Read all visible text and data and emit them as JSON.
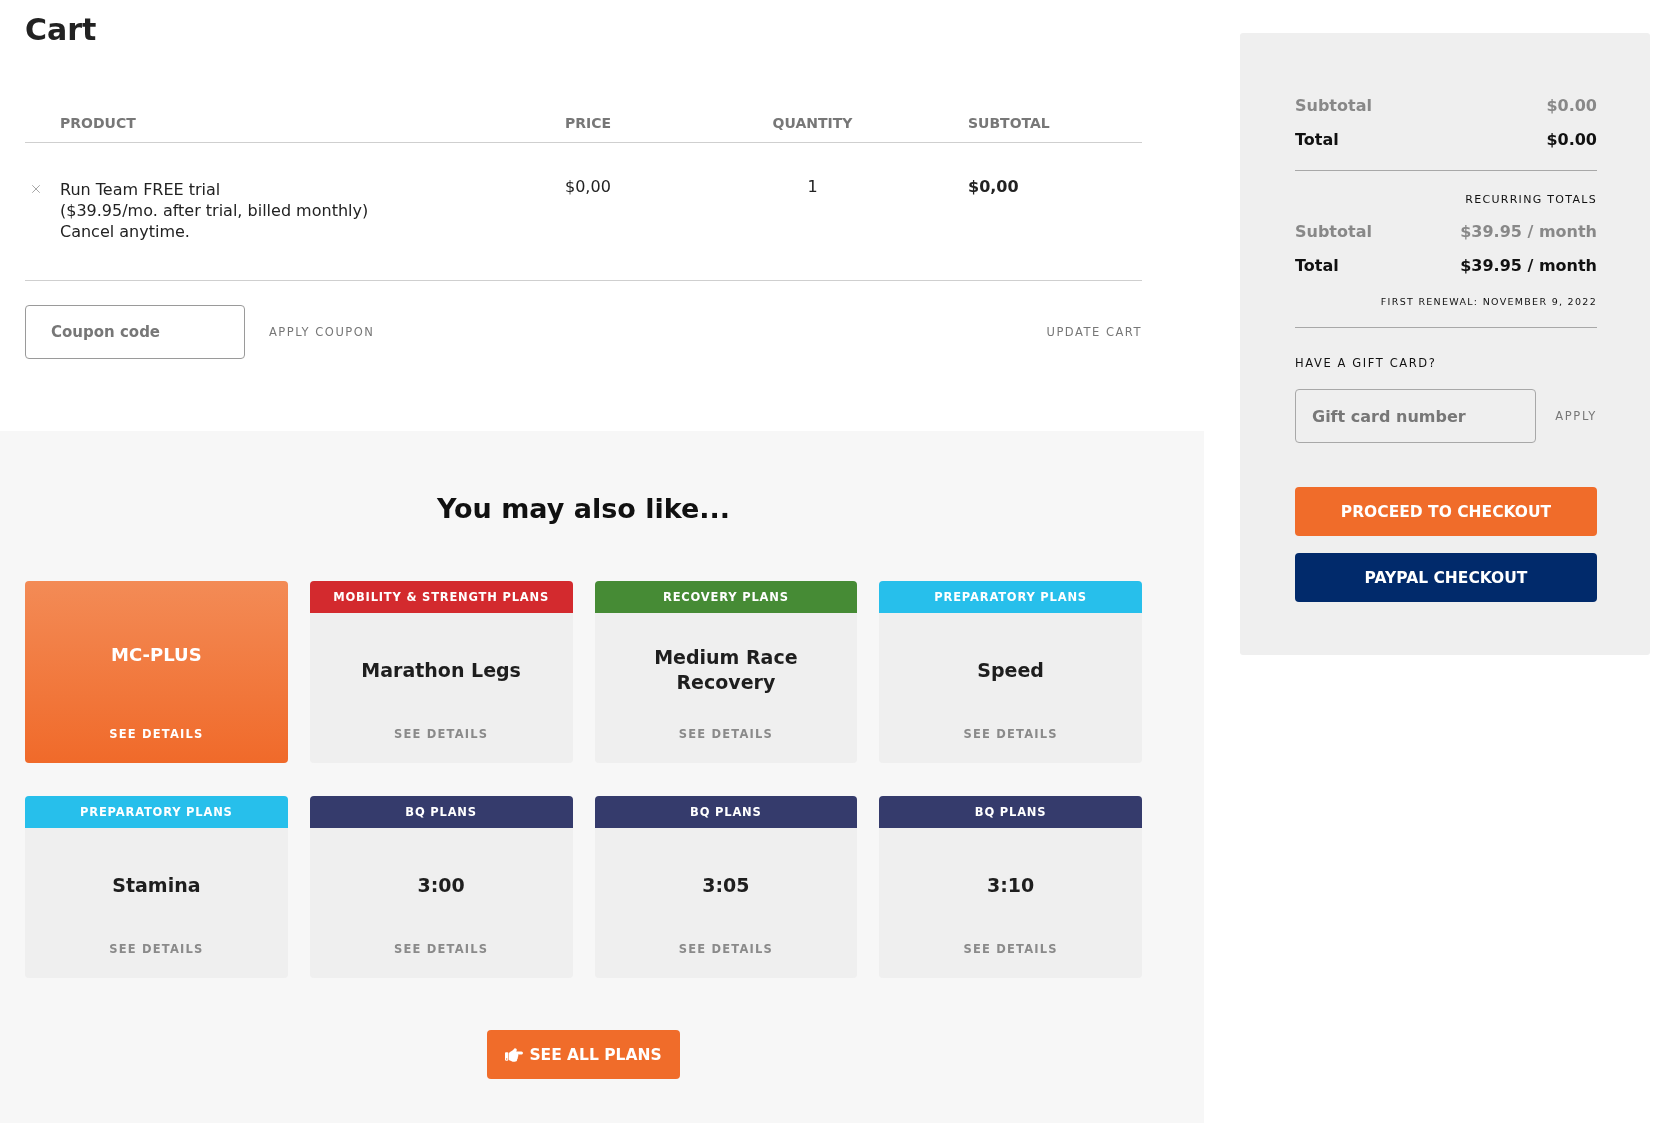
{
  "page": {
    "title": "Cart"
  },
  "cart_table": {
    "columns": [
      "PRODUCT",
      "PRICE",
      "QUANTITY",
      "SUBTOTAL"
    ],
    "rows": [
      {
        "product": "Run Team FREE trial\n($39.95/mo. after trial, billed monthly)\nCancel anytime.",
        "price": "$0,00",
        "quantity": "1",
        "subtotal": "$0,00"
      }
    ]
  },
  "coupon": {
    "placeholder": "Coupon code",
    "apply_button": "APPLY COUPON",
    "update_button": "UPDATE CART"
  },
  "recommendations": {
    "title": "You may also like...",
    "cards": [
      {
        "kind": "featured",
        "name": "MC-PLUS",
        "link": "SEE DETAILS"
      },
      {
        "kind": "category",
        "category": "MOBILITY & STRENGTH PLANS",
        "color": "#d32a2e",
        "name": "Marathon Legs",
        "link": "SEE DETAILS"
      },
      {
        "kind": "category",
        "category": "RECOVERY PLANS",
        "color": "#468b35",
        "name": "Medium Race Recovery",
        "link": "SEE DETAILS"
      },
      {
        "kind": "category",
        "category": "PREPARATORY PLANS",
        "color": "#27bfeb",
        "name": "Speed",
        "link": "SEE DETAILS"
      },
      {
        "kind": "category",
        "category": "PREPARATORY PLANS",
        "color": "#27bfeb",
        "name": "Stamina",
        "link": "SEE DETAILS"
      },
      {
        "kind": "category",
        "category": "BQ PLANS",
        "color": "#353b6c",
        "name": "3:00",
        "link": "SEE DETAILS"
      },
      {
        "kind": "category",
        "category": "BQ PLANS",
        "color": "#353b6c",
        "name": "3:05",
        "link": "SEE DETAILS"
      },
      {
        "kind": "category",
        "category": "BQ PLANS",
        "color": "#353b6c",
        "name": "3:10",
        "link": "SEE DETAILS"
      }
    ],
    "button": "SEE ALL PLANS"
  },
  "summary": {
    "totals": [
      {
        "kind": "subtotal",
        "label": "Subtotal",
        "value": "$0.00"
      },
      {
        "kind": "total",
        "label": "Total",
        "value": "$0.00"
      }
    ],
    "recurring_heading": "RECURRING TOTALS",
    "recurring": [
      {
        "kind": "subtotal",
        "label": "Subtotal",
        "value": "$39.95 / month"
      },
      {
        "kind": "total",
        "label": "Total",
        "value": "$39.95 / month"
      }
    ],
    "first_renewal": "FIRST RENEWAL: NOVEMBER 9, 2022",
    "gift_heading": "HAVE A GIFT CARD?",
    "gift_placeholder": "Gift card number",
    "gift_apply": "APPLY",
    "buttons": [
      {
        "kind": "primary",
        "label": "PROCEED TO CHECKOUT"
      },
      {
        "kind": "paypal",
        "label": "PAYPAL CHECKOUT"
      }
    ]
  }
}
